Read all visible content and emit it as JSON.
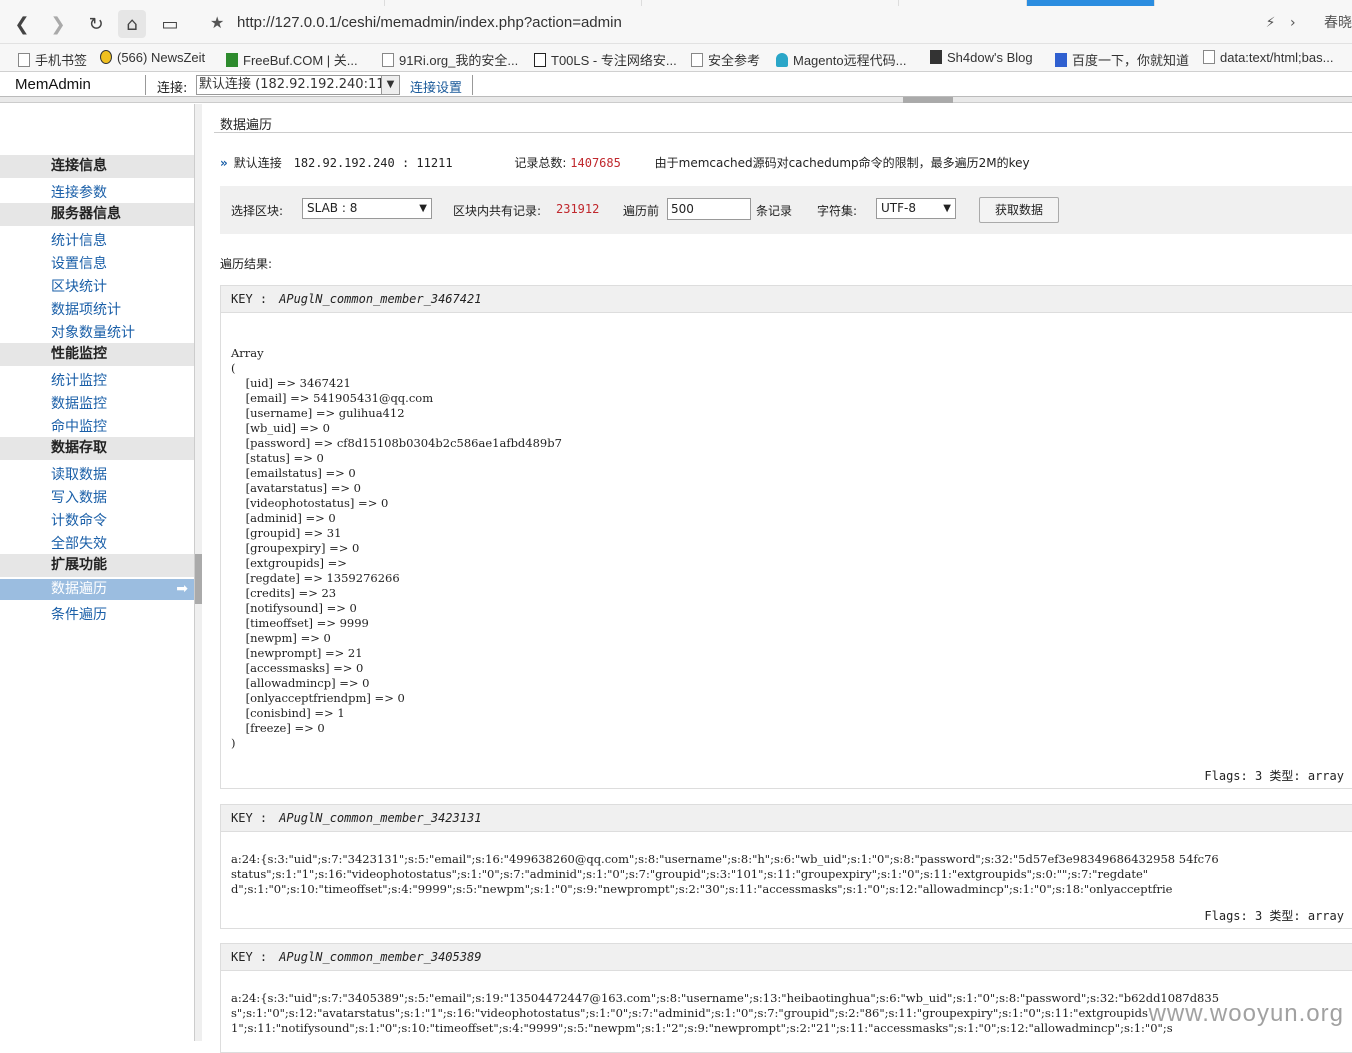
{
  "browser": {
    "url": "http://127.0.0.1/ceshi/memadmin/index.php?action=admin",
    "right_text": "春晓",
    "bookmarks": [
      "手机书签",
      "(566) NewsZeit",
      "FreeBuf.COM | 关...",
      "91Ri.org_我的安全...",
      "T00LS - 专注网络安...",
      "安全参考",
      "Magento远程代码...",
      "Sh4dow's Blog",
      "百度一下，你就知道",
      "data:text/html;bas..."
    ]
  },
  "app": {
    "logo": "MemAdmin",
    "conn_label": "连接:",
    "conn_value": "默认连接 (182.92.192.240:11211",
    "conn_settings": "连接设置"
  },
  "sidebar": {
    "groups": [
      {
        "title": "连接信息",
        "items": [
          "连接参数"
        ]
      },
      {
        "title": "服务器信息",
        "items": [
          "统计信息",
          "设置信息",
          "区块统计",
          "数据项统计",
          "对象数量统计"
        ]
      },
      {
        "title": "性能监控",
        "items": [
          "统计监控",
          "数据监控",
          "命中监控"
        ]
      },
      {
        "title": "数据存取",
        "items": [
          "读取数据",
          "写入数据",
          "计数命令",
          "全部失效"
        ]
      },
      {
        "title": "扩展功能",
        "items": [
          "数据遍历",
          "条件遍历"
        ]
      }
    ],
    "active": "数据遍历"
  },
  "main": {
    "title": "数据遍历",
    "conn_name": "默认连接",
    "conn_addr": "182.92.192.240 : 11211",
    "total_label": "记录总数:",
    "total_value": "1407685",
    "notice": "由于memcached源码对cachedump命令的限制，最多遍历2M的key",
    "select_slab_label": "选择区块:",
    "slab_value": "SLAB : 8",
    "slab_records_label": "区块内共有记录:",
    "slab_records_value": "231912",
    "traverse_label": "遍历前",
    "traverse_value": "500",
    "records_unit": "条记录",
    "charset_label": "字符集:",
    "charset_value": "UTF-8",
    "fetch_button": "获取数据",
    "result_label": "遍历结果:"
  },
  "records": [
    {
      "key_label": "KEY :",
      "key": "APuglN_common_member_3467421",
      "body": "Array\n(\n    [uid] => 3467421\n    [email] => 541905431@qq.com\n    [username] => gulihua412\n    [wb_uid] => 0\n    [password] => cf8d15108b0304b2c586ae1afbd489b7\n    [status] => 0\n    [emailstatus] => 0\n    [avatarstatus] => 0\n    [videophotostatus] => 0\n    [adminid] => 0\n    [groupid] => 31\n    [groupexpiry] => 0\n    [extgroupids] => \n    [regdate] => 1359276266\n    [credits] => 23\n    [notifysound] => 0\n    [timeoffset] => 9999\n    [newpm] => 0\n    [newprompt] => 21\n    [accessmasks] => 0\n    [allowadmincp] => 0\n    [onlyacceptfriendpm] => 0\n    [conisbind] => 1\n    [freeze] => 0\n)",
      "flags": "Flags: 3   类型: array"
    },
    {
      "key_label": "KEY :",
      "key": "APuglN_common_member_3423131",
      "body": "a:24:{s:3:\"uid\";s:7:\"3423131\";s:5:\"email\";s:16:\"499638260@qq.com\";s:8:\"username\";s:8:\"h\";s:6:\"wb_uid\";s:1:\"0\";s:8:\"password\";s:32:\"5d57ef3e98349686432958 54fc76\nstatus\";s:1:\"1\";s:16:\"videophotostatus\";s:1:\"0\";s:7:\"adminid\";s:1:\"0\";s:7:\"groupid\";s:3:\"101\";s:11:\"groupexpiry\";s:1:\"0\";s:11:\"extgroupids\";s:0:\"\";s:7:\"regdate\"\nd\";s:1:\"0\";s:10:\"timeoffset\";s:4:\"9999\";s:5:\"newpm\";s:1:\"0\";s:9:\"newprompt\";s:2:\"30\";s:11:\"accessmasks\";s:1:\"0\";s:12:\"allowadmincp\";s:1:\"0\";s:18:\"onlyacceptfrie",
      "flags": "Flags: 3   类型: array"
    },
    {
      "key_label": "KEY :",
      "key": "APuglN_common_member_3405389",
      "body": "a:24:{s:3:\"uid\";s:7:\"3405389\";s:5:\"email\";s:19:\"13504472447@163.com\";s:8:\"username\";s:13:\"heibaotinghua\";s:6:\"wb_uid\";s:1:\"0\";s:8:\"password\";s:32:\"b62dd1087d835\ns\";s:1:\"0\";s:12:\"avatarstatus\";s:1:\"1\";s:16:\"videophotostatus\";s:1:\"0\";s:7:\"adminid\";s:1:\"0\";s:7:\"groupid\";s:2:\"86\";s:11:\"groupexpiry\";s:1:\"0\";s:11:\"extgroupids\n1\";s:11:\"notifysound\";s:1:\"0\";s:10:\"timeoffset\";s:4:\"9999\";s:5:\"newpm\";s:1:\"2\";s:9:\"newprompt\";s:2:\"21\";s:11:\"accessmasks\";s:1:\"0\";s:12:\"allowadmincp\";s:1:\"0\";s",
      "flags": ""
    }
  ],
  "watermark": "www.wooyun.org"
}
